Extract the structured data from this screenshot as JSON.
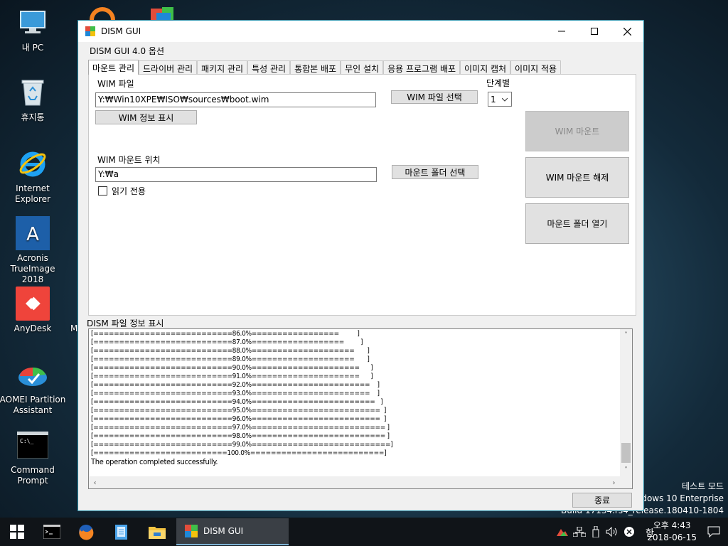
{
  "desktop": {
    "icons": [
      {
        "label": "내 PC",
        "icon": "computer-icon"
      },
      {
        "label": "휴지통",
        "icon": "recycle-bin-icon"
      },
      {
        "label": "Internet Explorer",
        "icon": "internet-explorer-icon"
      },
      {
        "label": "Acronis\nTrueImage 2018",
        "line1": "Acronis",
        "line2": "TrueImage 2018",
        "icon": "acronis-icon"
      },
      {
        "label": "AnyDesk",
        "icon": "anydesk-icon"
      },
      {
        "label": "AOMEI Partition Assistant",
        "line1": "AOMEI Partition",
        "line2": "Assistant",
        "icon": "aomei-icon"
      },
      {
        "label": "Command Prompt",
        "line1": "Command",
        "line2": "Prompt",
        "icon": "command-prompt-icon"
      }
    ],
    "fragment_letter": "M"
  },
  "watermark": {
    "line1": "테스트 모드",
    "line2": "Windows 10 Enterprise",
    "line3": "Build 17134.rs4_release.180410-1804"
  },
  "window": {
    "title": "DISM GUI",
    "menu": {
      "options": "DISM GUI 4.0 옵션"
    },
    "tabs": [
      "마운트 관리",
      "드라이버 관리",
      "패키지 관리",
      "특성 관리",
      "통합본 배포",
      "무인 설치",
      "응용 프로그램 배포",
      "이미지 캡처",
      "이미지 적용"
    ],
    "active_tab": "마운트 관리",
    "mount": {
      "wim_file_label": "WIM 파일",
      "wim_file_value": "Y:₩Win10XPE₩ISO₩sources₩boot.wim",
      "wim_file_select": "WIM 파일 선택",
      "wim_info_button": "WIM 정보 표시",
      "index_label": "단계별",
      "index_value": "1",
      "mount_location_label": "WIM 마운트 위치",
      "mount_location_value": "Y:₩a",
      "mount_folder_select": "마운트 폴더 선택",
      "read_only_label": "읽기 전용",
      "mount_button": "WIM 마운트",
      "unmount_button": "WIM 마운트 해제",
      "open_folder_button": "마운트 폴더 열기"
    },
    "log": {
      "label": "DISM 파일 정보 표시",
      "lines": [
        "[===========================86.0%=================          ]",
        "[===========================87.0%==================         ]",
        "[===========================88.0%====================       ]",
        "[===========================89.0%====================       ]",
        "[===========================90.0%=====================      ]",
        "[===========================91.0%=====================      ]",
        "[===========================92.0%=======================    ]",
        "[===========================93.0%=======================    ]",
        "[===========================94.0%========================   ]",
        "[===========================95.0%=========================  ]",
        "[===========================96.0%=========================  ]",
        "[===========================97.0%========================== ]",
        "[===========================98.0%========================== ]",
        "[===========================99.0%===========================]",
        "[==========================100.0%==========================]",
        "The operation completed successfully."
      ]
    },
    "close_button": "종료"
  },
  "taskbar": {
    "active_app": "DISM GUI",
    "ime": "한",
    "time": "오후 4:43",
    "date": "2018-06-15"
  }
}
